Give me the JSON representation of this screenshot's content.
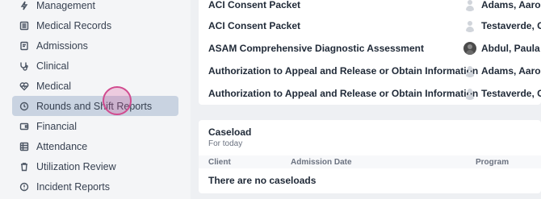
{
  "sidebar": {
    "items": [
      {
        "label": "Management",
        "icon": "lightning-icon"
      },
      {
        "label": "Medical Records",
        "icon": "list-icon"
      },
      {
        "label": "Admissions",
        "icon": "clipboard-icon"
      },
      {
        "label": "Clinical",
        "icon": "stethoscope-icon"
      },
      {
        "label": "Medical",
        "icon": "heart-pulse-icon"
      },
      {
        "label": "Rounds and Shift Reports",
        "icon": "clock-icon",
        "active": true
      },
      {
        "label": "Financial",
        "icon": "wallet-icon"
      },
      {
        "label": "Attendance",
        "icon": "table-icon"
      },
      {
        "label": "Utilization Review",
        "icon": "trash-icon"
      },
      {
        "label": "Incident Reports",
        "icon": "alert-circle-icon"
      }
    ]
  },
  "documents": {
    "rows": [
      {
        "name": "ACI Consent Packet",
        "user": "Adams, Aaron",
        "avatar": "placeholder"
      },
      {
        "name": "ACI Consent Packet",
        "user": "Testaverde, Colin",
        "avatar": "placeholder"
      },
      {
        "name": "ASAM Comprehensive Diagnostic Assessment",
        "user": "Abdul, Paula",
        "avatar": "photo"
      },
      {
        "name": "Authorization to Appeal and Release or Obtain Information",
        "user": "Adams, Aaron",
        "avatar": "placeholder"
      },
      {
        "name": "Authorization to Appeal and Release or Obtain Information",
        "user": "Testaverde, Colin",
        "avatar": "placeholder"
      }
    ]
  },
  "caseload": {
    "title": "Caseload",
    "subtitle": "For today",
    "columns": [
      "Client",
      "Admission Date",
      "Program"
    ],
    "empty_text": "There are no caseloads"
  },
  "colors": {
    "active_bg": "#c9d3e1",
    "click_indicator": "#d14b8f"
  }
}
